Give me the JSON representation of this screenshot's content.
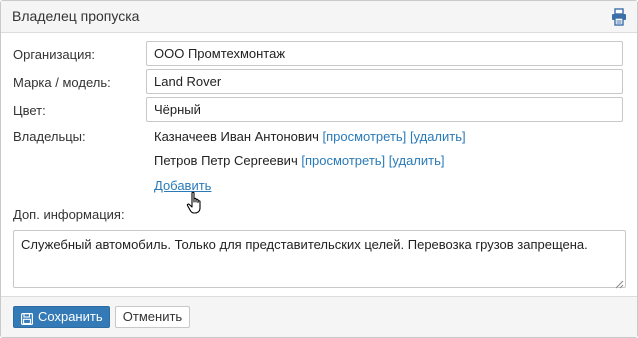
{
  "panel": {
    "title": "Владелец пропуска",
    "header_icon": "print-icon"
  },
  "form": {
    "organization": {
      "label": "Организация:",
      "value": "ООО Промтехмонтаж"
    },
    "model": {
      "label": "Марка / модель:",
      "value": "Land Rover"
    },
    "color": {
      "label": "Цвет:",
      "value": "Чёрный"
    },
    "owners": {
      "label": "Владельцы:",
      "items": [
        {
          "name": "Казначеев Иван Антонович",
          "view": "[просмотреть]",
          "delete": "[удалить]"
        },
        {
          "name": "Петров Петр Сергеевич",
          "view": "[просмотреть]",
          "delete": "[удалить]"
        }
      ],
      "add_label": "Добавить"
    },
    "info": {
      "label": "Доп. информация:",
      "value": "Служебный автомобиль. Только для представительских целей. Перевозка грузов запрещена."
    }
  },
  "footer": {
    "save_label": "Сохранить",
    "save_icon": "save-icon",
    "cancel_label": "Отменить"
  },
  "colors": {
    "link": "#2a7ab8",
    "primary_button": "#337ab7",
    "header_bg": "#f5f5f5"
  }
}
